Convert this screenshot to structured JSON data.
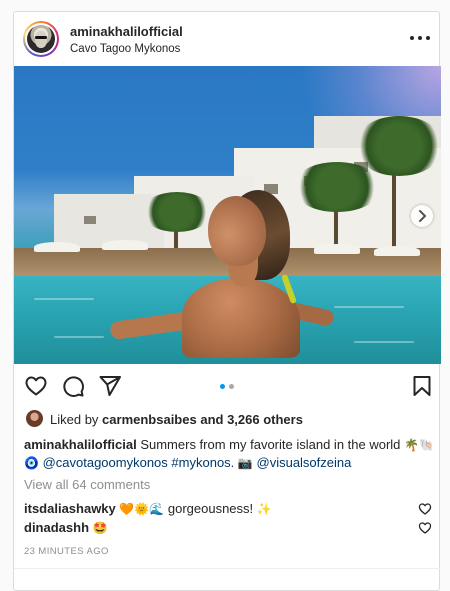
{
  "post": {
    "username": "aminakhalilofficial",
    "location": "Cavo Tagoo Mykonos",
    "likes": {
      "prefix": "Liked by",
      "liker": "carmenbsaibes",
      "suffix": "and 3,266 others"
    },
    "caption": {
      "username": "aminakhalilofficial",
      "text": "Summers from my favorite island in the world",
      "emoji_1": "🌴🐚",
      "emoji_2": "🧿",
      "mention_1": "@cavotagoomykonos",
      "hashtag": "#mykonos.",
      "emoji_3": "📷",
      "mention_2": "@visualsofzeina"
    },
    "view_comments": "View all 64 comments",
    "comments": [
      {
        "user": "itsdaliashawky",
        "emoji": "🧡🌞🌊",
        "text": "gorgeousness!",
        "emoji_after": "✨"
      },
      {
        "user": "dinadashh",
        "emoji": "🤩",
        "text": "",
        "emoji_after": ""
      }
    ],
    "timestamp": "23 MINUTES AGO",
    "carousel": {
      "total": 2,
      "active": 1
    }
  },
  "icons": {
    "more": "more-options-icon",
    "next": "chevron-right-icon",
    "like": "heart-icon",
    "comment": "comment-bubble-icon",
    "share": "paper-plane-icon",
    "save": "bookmark-icon"
  },
  "colors": {
    "accent_blue": "#0095f6",
    "dot_inactive": "#a8a8a8",
    "text": "#262626",
    "muted": "#8e8e8e",
    "link": "#00376b"
  }
}
